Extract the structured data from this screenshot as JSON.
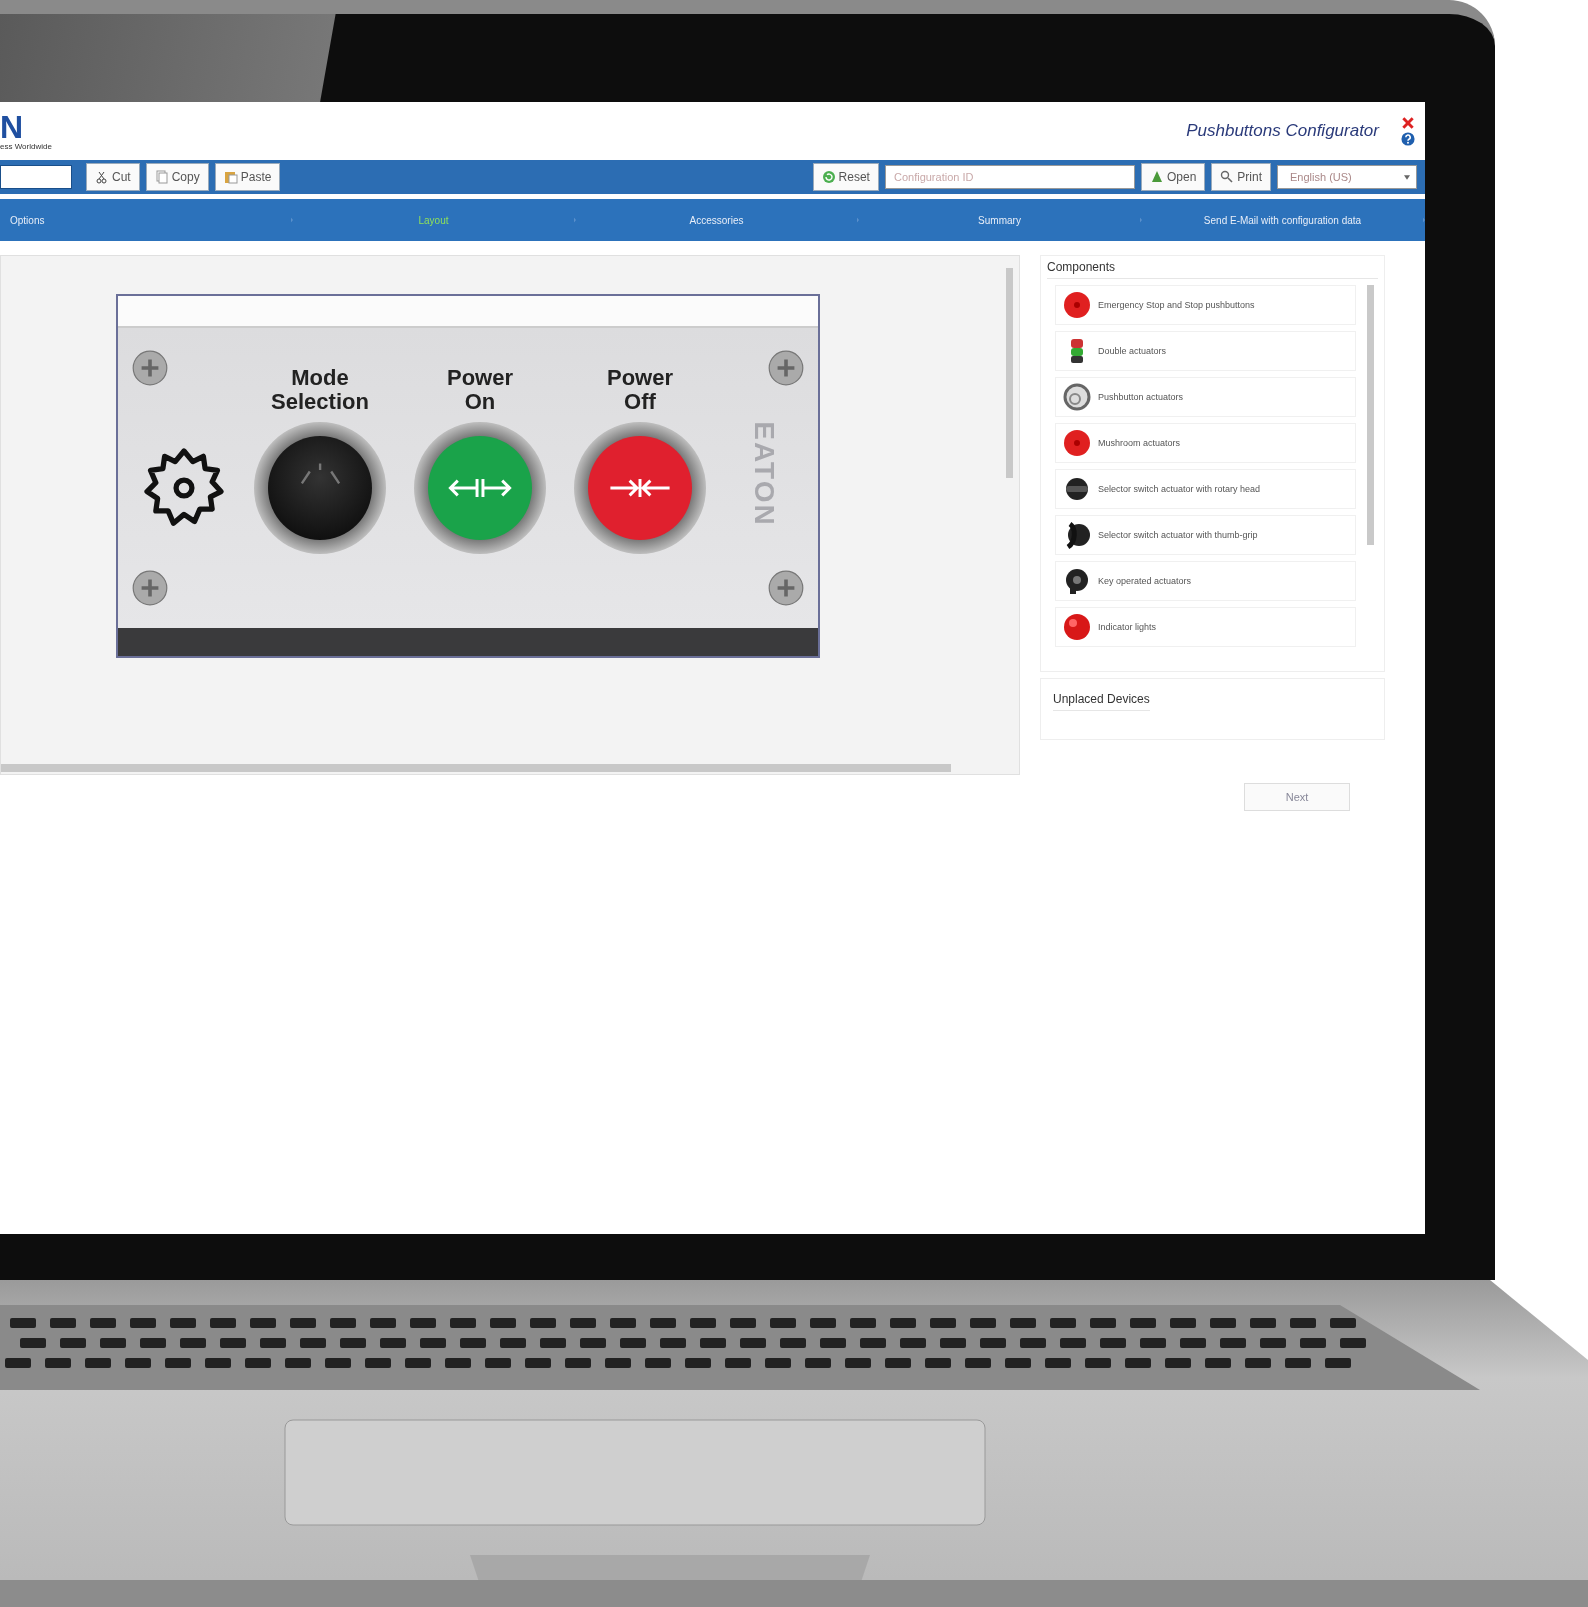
{
  "header": {
    "logo": "N",
    "tagline": "ess Worldwide",
    "title": "Pushbuttons Configurator"
  },
  "toolbar": {
    "left_buttons": [
      {
        "label": "Cut",
        "kind": "cut"
      },
      {
        "label": "Copy",
        "kind": "copy"
      },
      {
        "label": "Paste",
        "kind": "paste"
      }
    ],
    "reset": "Reset",
    "config_field": {
      "placeholder": "Configuration ID"
    },
    "right_buttons": [
      {
        "label": "Open",
        "kind": "open"
      },
      {
        "label": "Print",
        "kind": "print"
      }
    ],
    "language": "English (US)"
  },
  "steps": [
    {
      "label": "Options",
      "selected": false
    },
    {
      "label": "Layout",
      "selected": true
    },
    {
      "label": "Accessories",
      "selected": false
    },
    {
      "label": "Summary",
      "selected": false
    },
    {
      "label": "Send E-Mail with configuration data",
      "selected": false
    }
  ],
  "panel": {
    "brand": "EATON",
    "devices": [
      {
        "label": "Mode Selection",
        "kind": "selector"
      },
      {
        "label": "Power On",
        "kind": "start",
        "color": "#1aa34a"
      },
      {
        "label": "Power Off",
        "kind": "stop",
        "color": "#e0202e"
      }
    ]
  },
  "components": {
    "title": "Components",
    "items": [
      {
        "label": "Emergency Stop and Stop pushbuttons",
        "kind": "mushroom"
      },
      {
        "label": "Double actuators",
        "kind": "double"
      },
      {
        "label": "Pushbutton actuators",
        "kind": "ring"
      },
      {
        "label": "Mushroom actuators",
        "kind": "mushroom"
      },
      {
        "label": "Selector switch actuator with rotary head",
        "kind": "selector"
      },
      {
        "label": "Selector switch actuator with thumb-grip",
        "kind": "thumb"
      },
      {
        "label": "Key operated actuators",
        "kind": "key"
      },
      {
        "label": "Indicator lights",
        "kind": "lamp"
      }
    ]
  },
  "unplaced": {
    "title": "Unplaced Devices"
  },
  "next_button": "Next"
}
